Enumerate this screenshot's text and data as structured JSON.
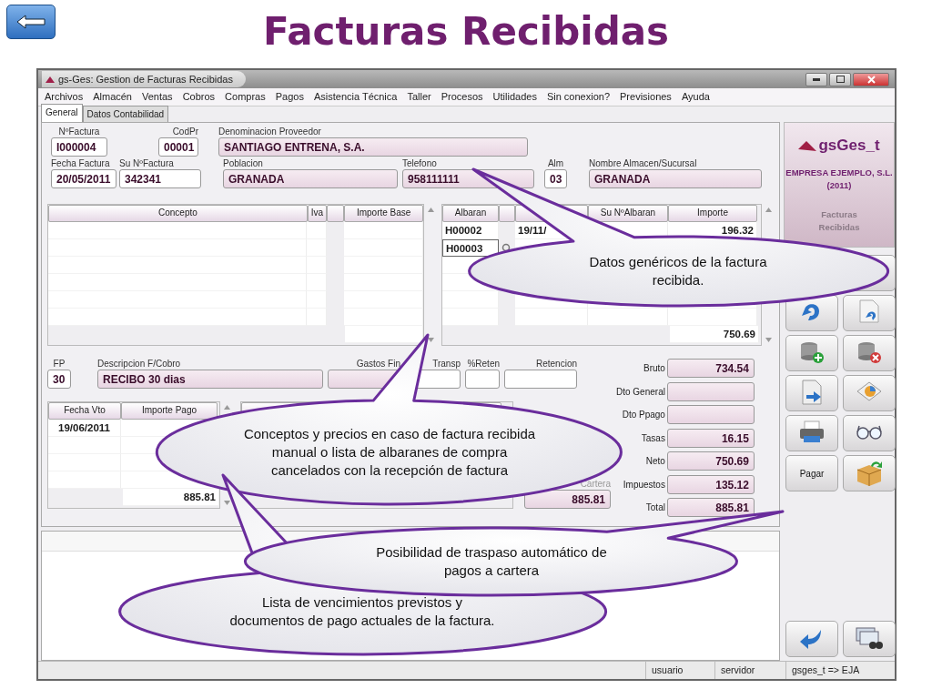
{
  "slide": {
    "title": "Facturas Recibidas"
  },
  "window": {
    "title": "gs-Ges: Gestion de Facturas Recibidas"
  },
  "menu": [
    "Archivos",
    "Almacén",
    "Ventas",
    "Cobros",
    "Compras",
    "Pagos",
    "Asistencia Técnica",
    "Taller",
    "Procesos",
    "Utilidades",
    "Sin conexion?",
    "Previsiones",
    "Ayuda"
  ],
  "tabs": [
    {
      "label": "General",
      "selected": true
    },
    {
      "label": "Datos Contabilidad",
      "selected": false
    }
  ],
  "header": {
    "rows": [
      [
        {
          "label": "NºFactura",
          "value": "I000004",
          "readonly": false
        },
        {
          "label": "CodPr",
          "value": "00001",
          "readonly": false
        },
        {
          "label": "Denominacion Proveedor",
          "value": "SANTIAGO ENTRENA, S.A.",
          "readonly": true
        }
      ],
      [
        {
          "label": "Fecha Factura",
          "value": "20/05/2011",
          "readonly": false
        },
        {
          "label": "Su NºFactura",
          "value": "342341",
          "readonly": false
        },
        {
          "label": "Poblacion",
          "value": "GRANADA",
          "readonly": true
        },
        {
          "label": "Telefono",
          "value": "958111111",
          "readonly": true
        },
        {
          "label": "Alm",
          "value": "03",
          "readonly": false
        },
        {
          "label": "Nombre Almacen/Sucursal",
          "value": "GRANADA",
          "readonly": true
        }
      ]
    ]
  },
  "concepts": {
    "columns": [
      {
        "kind": "text",
        "label": "Concepto"
      },
      {
        "kind": "text",
        "label": "Iva"
      },
      {
        "kind": "spacer"
      },
      {
        "kind": "text",
        "label": "Importe Base"
      }
    ]
  },
  "albaranes": {
    "columns": [
      {
        "kind": "text",
        "label": "Albaran"
      },
      {
        "kind": "spacer"
      },
      {
        "kind": "text"
      },
      {
        "kind": "text",
        "label": "Su NºAlbaran"
      },
      {
        "kind": "text",
        "label": "Importe"
      }
    ],
    "rows": [
      {
        "albaran": "H00002",
        "fecha": "19/11/",
        "importe": "196.32",
        "selected": false
      },
      {
        "albaran": "H00003",
        "selected": true
      }
    ],
    "total": "750.69"
  },
  "payment": [
    {
      "label": "FP",
      "value": "30",
      "readonly": false
    },
    {
      "label": "Descripcion F/Cobro",
      "value": "RECIBO 30 dias",
      "readonly": true
    },
    {
      "label": "Gastos Fin",
      "readonly": true
    },
    {
      "label": "Transp",
      "readonly": false
    },
    {
      "label": "%Reten",
      "readonly": false
    },
    {
      "label": "Retencion",
      "readonly": false
    }
  ],
  "vencimientos": {
    "columns": [
      "Fecha Vto",
      "Importe Pago"
    ],
    "rows": [
      {
        "fecha": "19/06/2011"
      }
    ],
    "total": "885.81"
  },
  "cartera": {
    "pagado_label": "Cartera",
    "pagado_value": "885.81"
  },
  "totals": [
    {
      "label": "Bruto",
      "value": "734.54"
    },
    {
      "label": "Dto General"
    },
    {
      "label": "Dto Ppago"
    },
    {
      "label": "Tasas",
      "value": "16.15"
    },
    {
      "label": "Neto",
      "value": "750.69"
    },
    {
      "label": "Impuestos",
      "value": "135.12"
    },
    {
      "label": "Total",
      "value": "885.81"
    }
  ],
  "sidebar": {
    "logo": "gsGes_t",
    "company": "EMPRESA EJEMPLO, S.L. (2011)",
    "module": "Facturas Recibidas",
    "pay_button": "Pagar"
  },
  "status_bar": [
    "usuario",
    "servidor",
    "gsges_t => EJA"
  ],
  "callouts": [
    {
      "text": "Datos genéricos de la factura recibida."
    },
    {
      "text": "Conceptos y precios en caso de factura recibida manual o lista de albaranes de compra cancelados con la recepción de factura"
    },
    {
      "text": "Posibilidad de traspaso automático de pagos a cartera"
    },
    {
      "text": "Lista de vencimientos previstos y documentos de pago actuales de la factura."
    }
  ]
}
